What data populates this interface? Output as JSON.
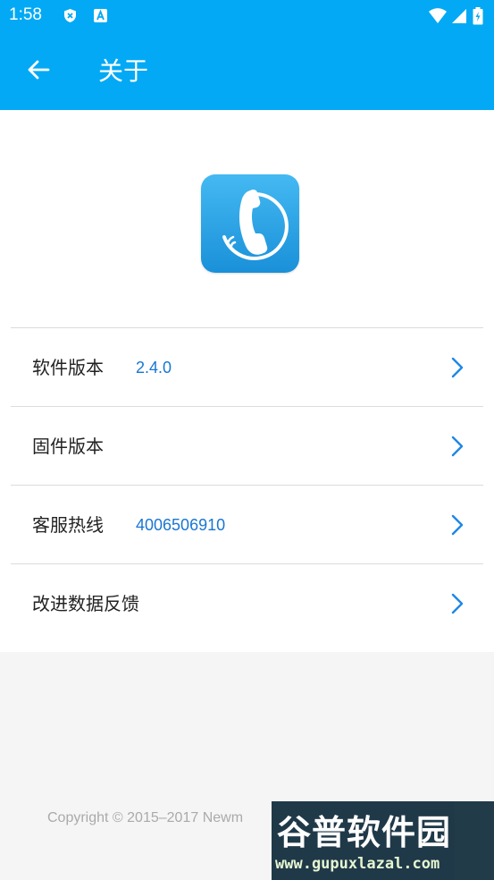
{
  "status_bar": {
    "time": "1:58"
  },
  "app_bar": {
    "title": "关于"
  },
  "about_list": [
    {
      "label": "软件版本",
      "value": "2.4.0"
    },
    {
      "label": "固件版本",
      "value": ""
    },
    {
      "label": "客服热线",
      "value": "4006506910"
    },
    {
      "label": "改进数据反馈",
      "value": ""
    }
  ],
  "footer": {
    "copyright": "Copyright © 2015–2017 Newm"
  },
  "watermark": {
    "brand": "谷普软件园",
    "url": "www.gupuxlazal.com"
  },
  "colors": {
    "primary": "#03a9f4",
    "value_text": "#1976d2",
    "chevron": "#1e88e5"
  }
}
